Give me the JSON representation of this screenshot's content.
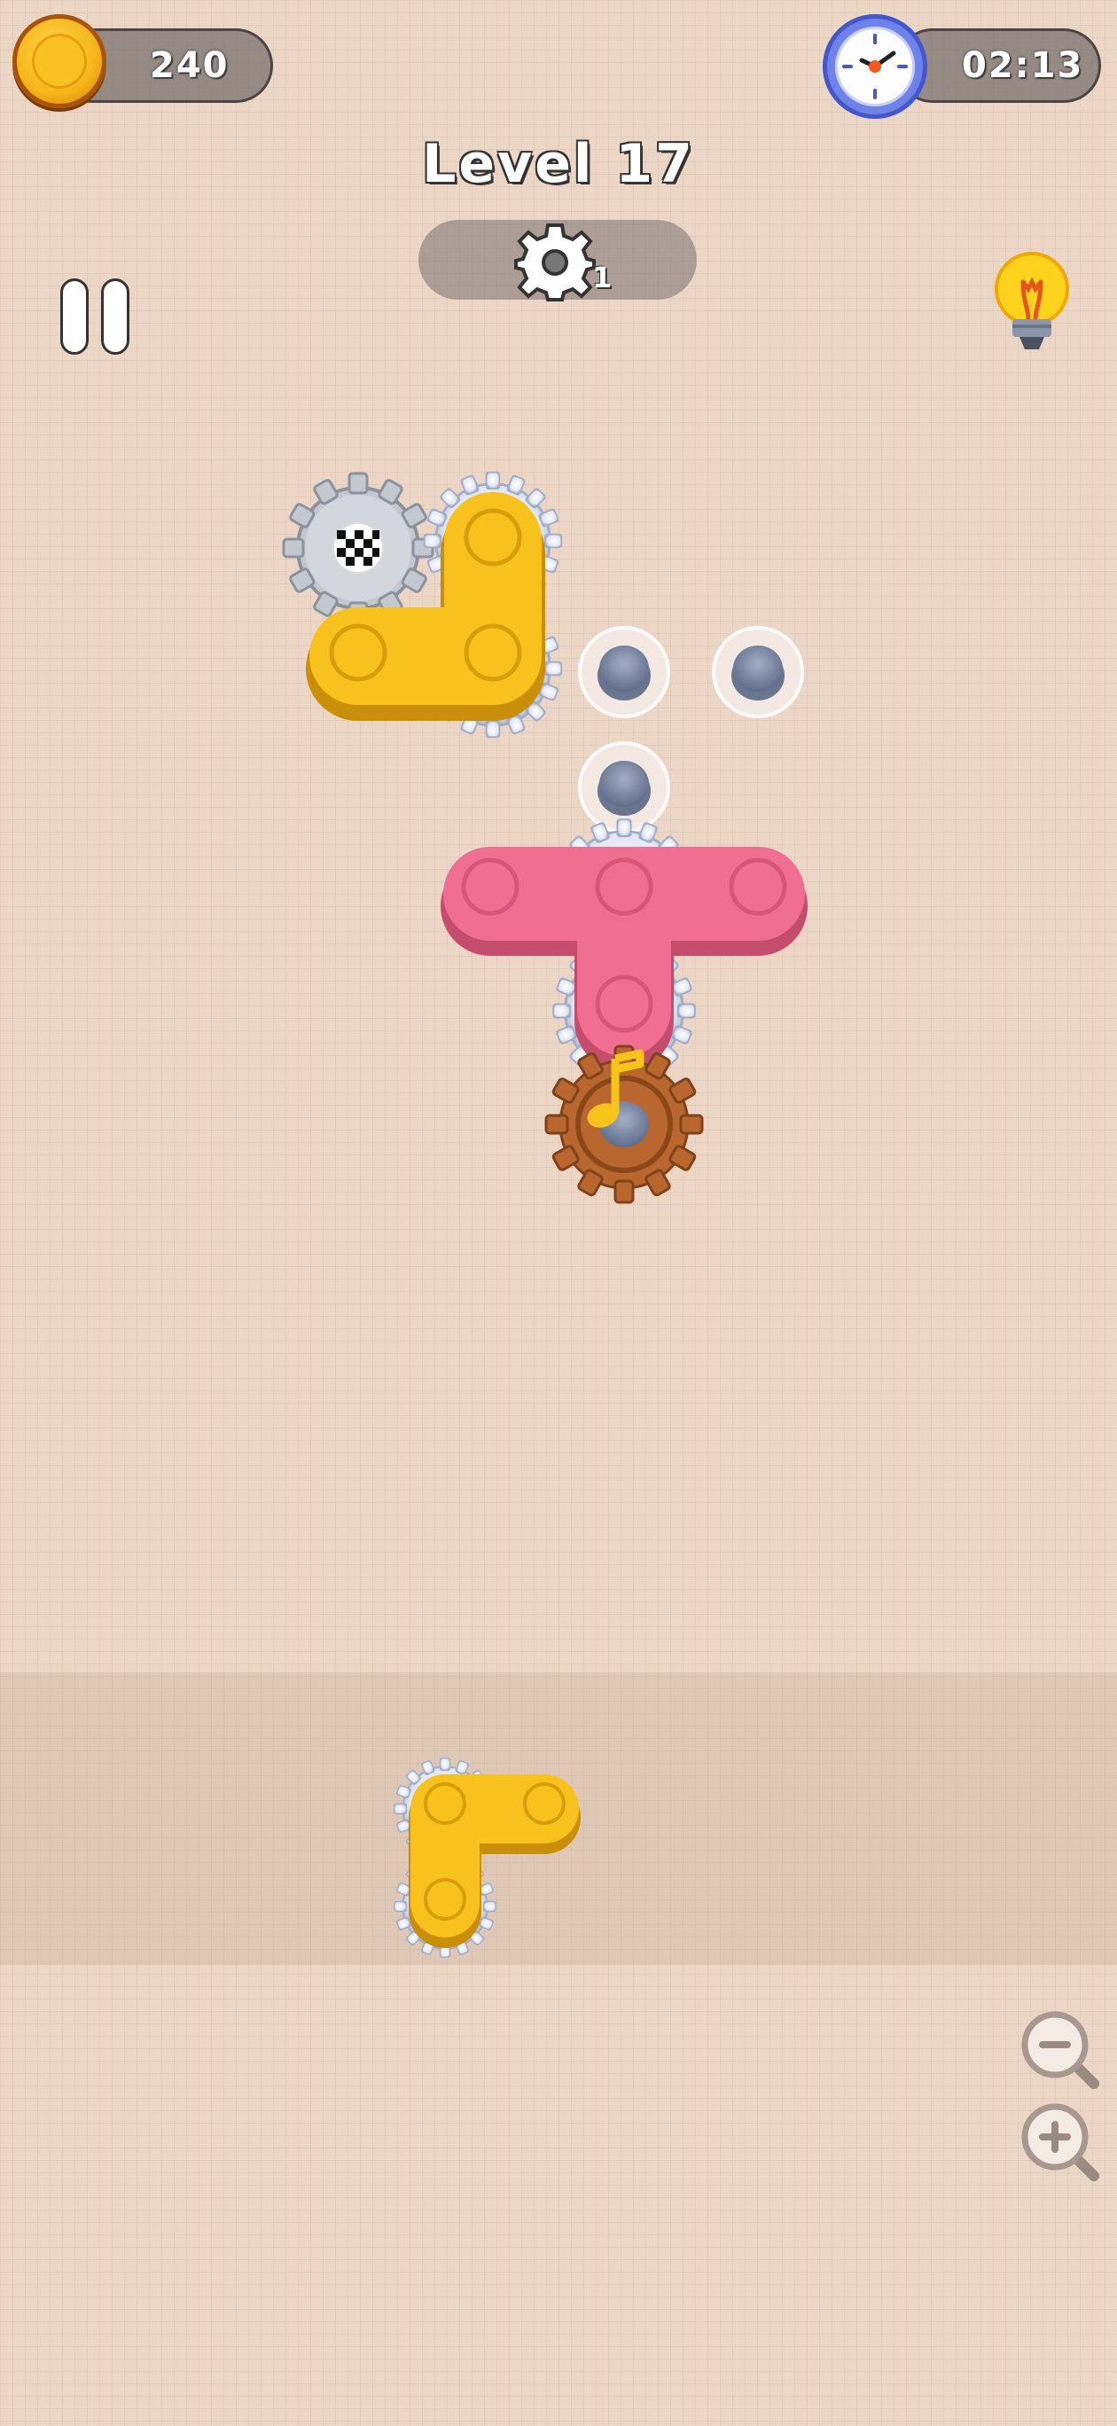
{
  "hud": {
    "coins": "240",
    "timer": "02:13",
    "level_title": "Level 17",
    "gear_target_count": "1"
  },
  "icons": {
    "coin": "coin-icon",
    "clock": "clock-icon",
    "gear": "gear-icon",
    "pause": "pause-icon",
    "hint": "lightbulb-icon",
    "zoom_out": "zoom-out-icon",
    "zoom_in": "zoom-in-icon",
    "goal": "checkered-flag-icon",
    "music": "music-note-icon"
  },
  "colors": {
    "background": "#ecd7c7",
    "yellow_spinner": "#f8c21e",
    "pink_spinner": "#ef6e91",
    "goal_gear": "#c9cdd3",
    "bronze_gear": "#b9672e",
    "peg": "#8491aa"
  }
}
